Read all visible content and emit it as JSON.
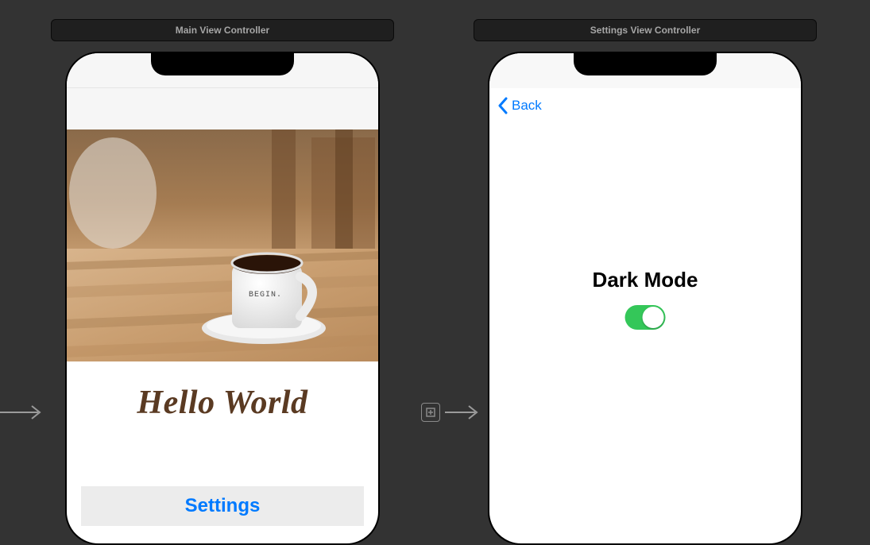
{
  "canvas": {
    "main_label": "Main View Controller",
    "settings_label": "Settings View Controller"
  },
  "main_screen": {
    "image": {
      "description": "coffee-mug-on-table",
      "mug_text": "BEGIN."
    },
    "title": "Hello World",
    "settings_button": "Settings"
  },
  "settings_screen": {
    "back_label": "Back",
    "toggle_label": "Dark Mode",
    "toggle_state": "on"
  }
}
